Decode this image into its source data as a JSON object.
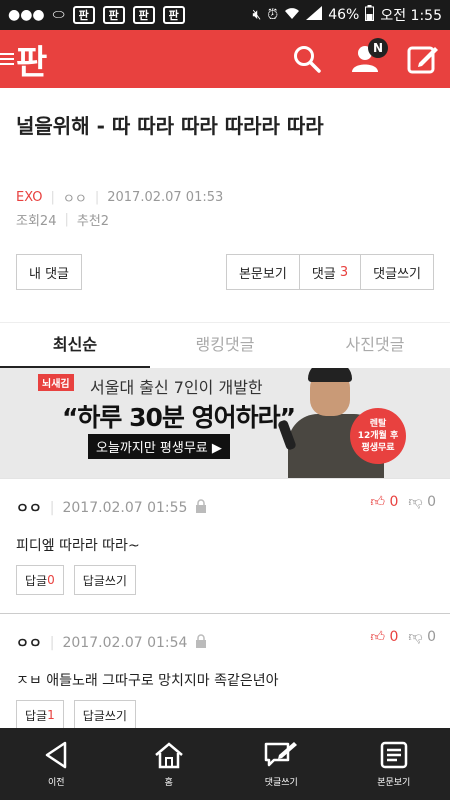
{
  "status": {
    "left_icons": [
      "chat-icon",
      "capsule-icon",
      "pann-app-icon",
      "pann-app-icon",
      "pann-app-icon",
      "pann-app-icon"
    ],
    "pann_glyph": "판",
    "battery": "46%",
    "time": "오전 1:55"
  },
  "header": {
    "logo": "판"
  },
  "post": {
    "title": "널을위해 - 따 따라 따라 따라라 따라",
    "category": "EXO",
    "author": "ㅇㅇ",
    "datetime": "2017.02.07 01:53",
    "views_label": "조회",
    "views": "24",
    "recommends_label": "추천",
    "recommends": "2"
  },
  "buttons": {
    "my_comment": "내 댓글",
    "view_post": "본문보기",
    "comments_label": "댓글",
    "comments_count": "3",
    "write_comment": "댓글쓰기"
  },
  "tabs": [
    "최신순",
    "랭킹댓글",
    "사진댓글"
  ],
  "ad": {
    "tag": "뇌새김",
    "line1": "서울대 출신 7인이 개발한",
    "line2": "“하루 30분 영어하라”",
    "cta": "오늘까지만 평생무료 ▶",
    "badge_l1": "렌탈",
    "badge_l2": "12개월 후",
    "badge_l3": "평생무료"
  },
  "comments": [
    {
      "author": "ㅇㅇ",
      "datetime": "2017.02.07 01:55",
      "body": "피디엪 따라라 따라~",
      "reply_label": "답글",
      "reply_count": "0",
      "write_reply": "답글쓰기",
      "up": "0",
      "down": "0"
    },
    {
      "author": "ㅇㅇ",
      "datetime": "2017.02.07 01:54",
      "body": "ㅈㅂ 애들노래 그따구로 망치지마 족같은년아",
      "reply_label": "답글",
      "reply_count": "1",
      "write_reply": "답글쓰기",
      "up": "0",
      "down": "0"
    }
  ],
  "bottom_nav": [
    "이전",
    "홈",
    "댓글쓰기",
    "본문보기"
  ],
  "colors": {
    "brand": "#e8413f",
    "nav_bg": "#222222"
  }
}
